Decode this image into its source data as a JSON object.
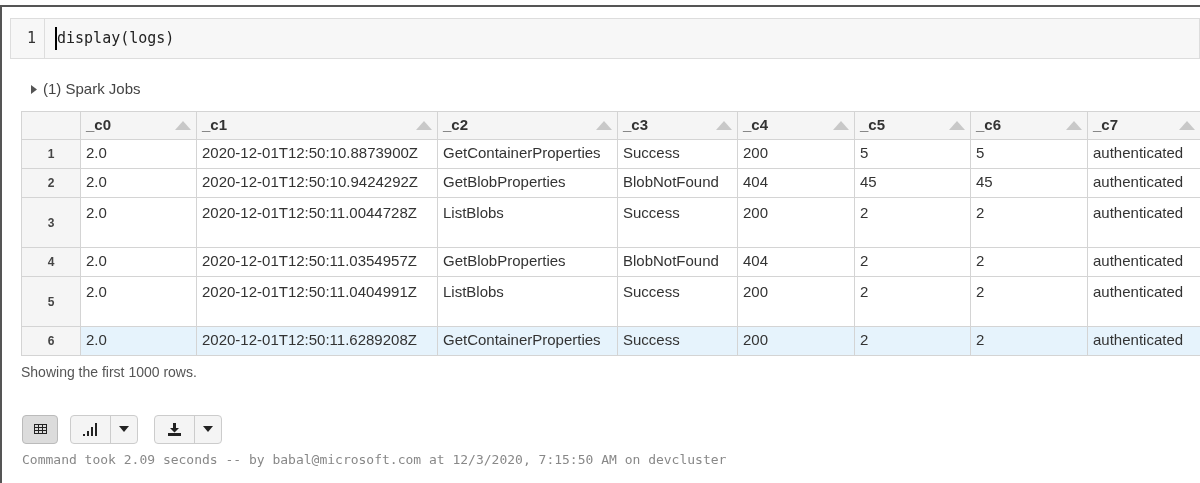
{
  "editor": {
    "line_number": "1",
    "code": "display(logs)"
  },
  "spark_jobs": {
    "label": "(1) Spark Jobs",
    "expanded": false
  },
  "table": {
    "columns": [
      "_c0",
      "_c1",
      "_c2",
      "_c3",
      "_c4",
      "_c5",
      "_c6",
      "_c7"
    ],
    "rows": [
      {
        "index": "1",
        "selected": false,
        "expanded": false,
        "cells": [
          "2.0",
          "2020-12-01T12:50:10.8873900Z",
          "GetContainerProperties",
          "Success",
          "200",
          "5",
          "5",
          "authenticated"
        ]
      },
      {
        "index": "2",
        "selected": false,
        "expanded": false,
        "cells": [
          "2.0",
          "2020-12-01T12:50:10.9424292Z",
          "GetBlobProperties",
          "BlobNotFound",
          "404",
          "45",
          "45",
          "authenticated"
        ]
      },
      {
        "index": "3",
        "selected": false,
        "expanded": true,
        "cells": [
          "2.0",
          "2020-12-01T12:50:11.0044728Z",
          "ListBlobs",
          "Success",
          "200",
          "2",
          "2",
          "authenticated"
        ]
      },
      {
        "index": "4",
        "selected": false,
        "expanded": false,
        "cells": [
          "2.0",
          "2020-12-01T12:50:11.0354957Z",
          "GetBlobProperties",
          "BlobNotFound",
          "404",
          "2",
          "2",
          "authenticated"
        ]
      },
      {
        "index": "5",
        "selected": false,
        "expanded": true,
        "cells": [
          "2.0",
          "2020-12-01T12:50:11.0404991Z",
          "ListBlobs",
          "Success",
          "200",
          "2",
          "2",
          "authenticated"
        ]
      },
      {
        "index": "6",
        "selected": true,
        "expanded": false,
        "cells": [
          "2.0",
          "2020-12-01T12:50:11.6289208Z",
          "GetContainerProperties",
          "Success",
          "200",
          "2",
          "2",
          "authenticated"
        ]
      }
    ]
  },
  "row_note": "Showing the first 1000 rows.",
  "view_buttons": [
    {
      "kind": "table",
      "selected": true
    },
    {
      "kind": "chart",
      "selected": false
    },
    {
      "kind": "download",
      "selected": false
    }
  ],
  "footer": "Command took 2.09 seconds -- by babal@microsoft.com at 12/3/2020, 7:15:50 AM on devcluster"
}
